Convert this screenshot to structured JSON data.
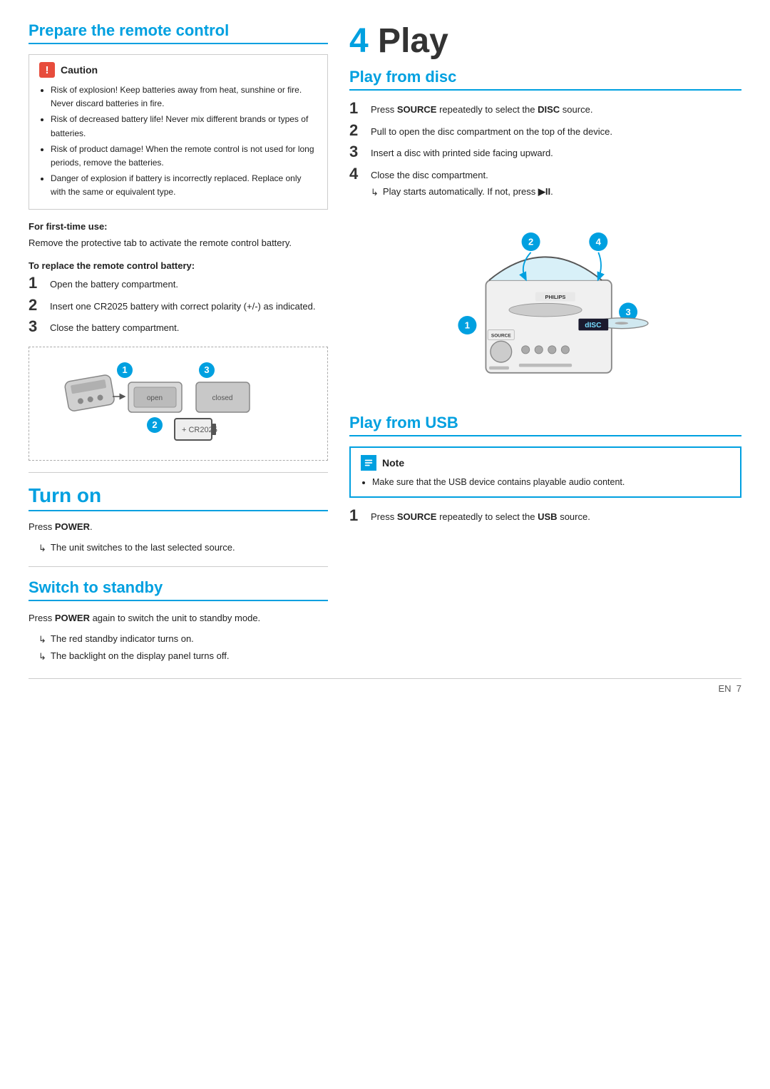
{
  "left": {
    "prepare_title": "Prepare the remote control",
    "caution": {
      "label": "Caution",
      "items": [
        "Risk of explosion! Keep batteries away from heat, sunshine or fire. Never discard batteries in fire.",
        "Risk of decreased battery life! Never mix different brands or types of batteries.",
        "Risk of product damage! When the remote control is not used for long periods, remove the batteries.",
        "Danger of explosion if battery is incorrectly replaced. Replace only with the same or equivalent type."
      ]
    },
    "first_time_heading": "For first-time use:",
    "first_time_text": "Remove the protective tab to activate the remote control battery.",
    "replace_heading": "To replace the remote control battery:",
    "replace_steps": [
      {
        "num": "1",
        "text": "Open the battery compartment."
      },
      {
        "num": "2",
        "text": "Insert one CR2025 battery with correct polarity (+/-) as indicated."
      },
      {
        "num": "3",
        "text": "Close the battery compartment."
      }
    ],
    "turn_on_title": "Turn on",
    "turn_on_press": "Press ",
    "turn_on_press_bold": "POWER",
    "turn_on_arrow": "The unit switches to the last selected source.",
    "standby_title": "Switch to standby",
    "standby_text_1": "Press ",
    "standby_text_bold": "POWER",
    "standby_text_2": " again to switch the unit to standby mode.",
    "standby_arrow1": "The red standby indicator turns on.",
    "standby_arrow2": "The backlight on the display panel turns off."
  },
  "right": {
    "chapter_num": "4",
    "chapter_title": "Play",
    "play_disc_title": "Play from disc",
    "play_disc_steps": [
      {
        "num": "1",
        "text": "Press ",
        "bold": "SOURCE",
        "text2": " repeatedly to select the ",
        "bold2": "DISC",
        "text3": " source."
      },
      {
        "num": "2",
        "text": "Pull to open the disc compartment on the top of the device."
      },
      {
        "num": "3",
        "text": "Insert a disc with printed side facing upward."
      },
      {
        "num": "4",
        "text": "Close the disc compartment.",
        "arrow": "Play starts automatically. If not, press ▶II."
      }
    ],
    "play_usb_title": "Play from USB",
    "note": {
      "label": "Note",
      "items": [
        "Make sure that the USB device contains playable audio content."
      ]
    },
    "play_usb_steps": [
      {
        "num": "1",
        "text": "Press ",
        "bold": "SOURCE",
        "text2": " repeatedly to select the ",
        "bold2": "USB",
        "text3": " source."
      }
    ]
  },
  "footer": {
    "lang": "EN",
    "page": "7"
  }
}
